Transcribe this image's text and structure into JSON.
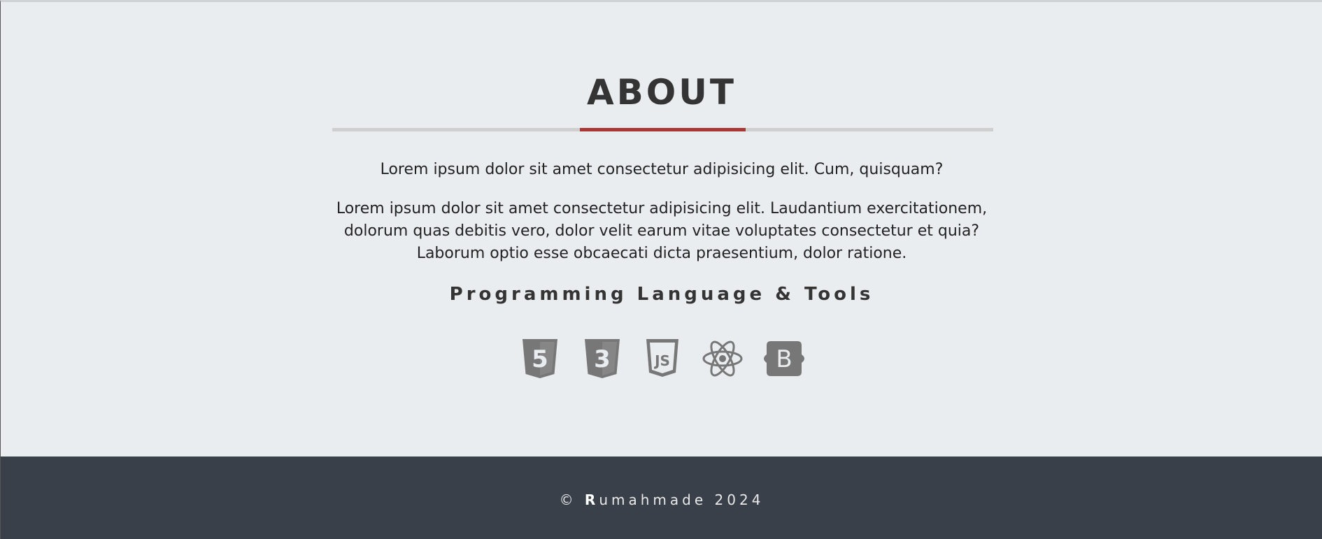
{
  "about": {
    "title": "ABOUT",
    "paragraph_1": "Lorem ipsum dolor sit amet consectetur adipisicing elit. Cum, quisquam?",
    "paragraph_2": "Lorem ipsum dolor sit amet consectetur adipisicing elit. Laudantium exercitationem, dolorum quas debitis vero, dolor velit earum vitae voluptates consectetur et quia? Laborum optio esse obcaecati dicta praesentium, dolor ratione.",
    "tools_title": "Programming Language & Tools",
    "tools": [
      {
        "name": "html5-icon",
        "label": "5"
      },
      {
        "name": "css3-icon",
        "label": "3"
      },
      {
        "name": "javascript-icon",
        "label": "JS"
      },
      {
        "name": "react-icon"
      },
      {
        "name": "bootstrap-icon",
        "label": "B"
      }
    ]
  },
  "footer": {
    "copyright_symbol": "©",
    "brand_initial": "R",
    "brand_rest": "umahmade",
    "year": "2024"
  },
  "colors": {
    "background": "#eaedf0",
    "heading": "#343434",
    "accent": "#a93733",
    "underline": "#cfcfcf",
    "icon": "#777777",
    "footer_bg": "#3a404a",
    "footer_text": "#e8e8e8"
  }
}
